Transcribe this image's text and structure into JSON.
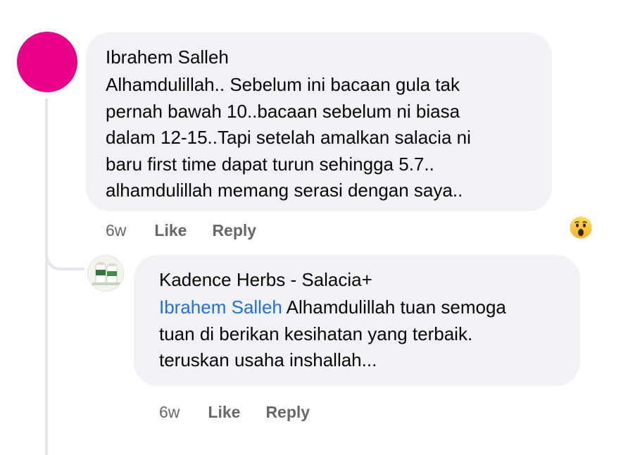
{
  "comment": {
    "author": "Ibrahem Salleh",
    "text_lines": [
      "Alhamdulillah.. Sebelum ini bacaan gula tak",
      "pernah bawah 10..bacaan sebelum ni biasa",
      "dalam 12-15..Tapi setelah amalkan salacia ni",
      "baru first time dapat turun sehingga 5.7..",
      "alhamdulillah memang serasi dengan saya.."
    ],
    "time": "6w",
    "like_label": "Like",
    "reply_label": "Reply",
    "reaction_icon": "wow-reaction-icon",
    "avatar_color": "#e8008a"
  },
  "reply": {
    "author": "Kadence Herbs - Salacia+",
    "mention": "Ibrahem Salleh",
    "text_after_mention": " Alhamdulillah tuan semoga",
    "text_lines": [
      "tuan di berikan kesihatan yang terbaik.",
      "teruskan usaha inshallah..."
    ],
    "time": "6w",
    "like_label": "Like",
    "reply_label": "Reply",
    "avatar_icon": "product-bottles-icon"
  },
  "colors": {
    "bubble": "#f0f2f5",
    "mention": "#216fdb",
    "meta": "#65676b",
    "thread_line": "#e4e6eb"
  }
}
